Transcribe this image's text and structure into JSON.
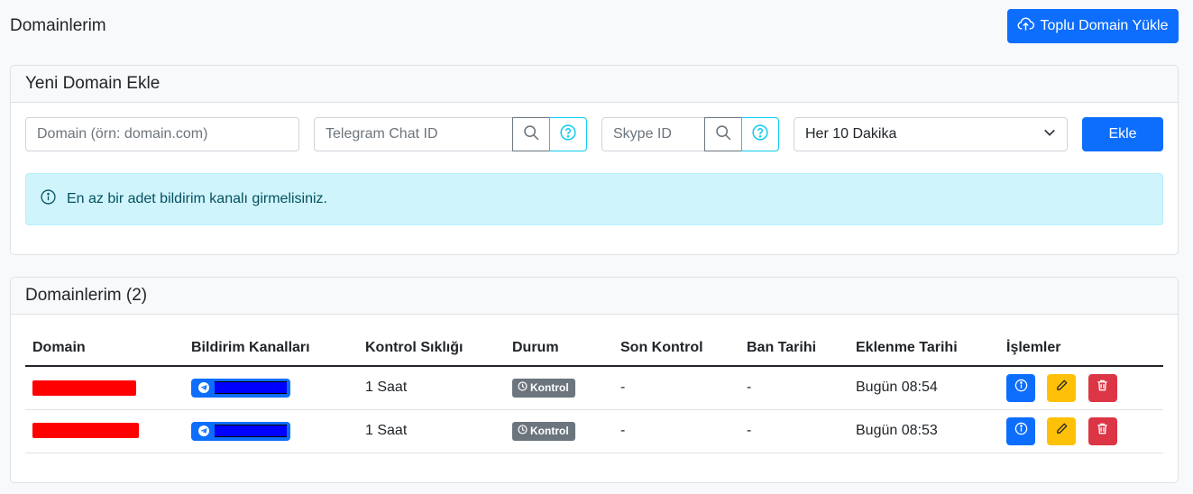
{
  "header": {
    "title": "Domainlerim",
    "bulk_upload_label": "Toplu Domain Yükle",
    "bulk_upload_icon": "cloud-upload-icon"
  },
  "new_domain": {
    "title": "Yeni Domain Ekle",
    "domain_placeholder": "Domain (örn: domain.com)",
    "telegram_placeholder": "Telegram Chat ID",
    "skype_placeholder": "Skype ID",
    "frequency_selected": "Her 10 Dakika",
    "add_label": "Ekle",
    "alert_text": "En az bir adet bildirim kanalı girmelisiniz."
  },
  "domains": {
    "title": "Domainlerim (2)",
    "columns": [
      "Domain",
      "Bildirim Kanalları",
      "Kontrol Sıklığı",
      "Durum",
      "Son Kontrol",
      "Ban Tarihi",
      "Eklenme Tarihi",
      "İşlemler"
    ],
    "rows": [
      {
        "frequency": "1 Saat",
        "status": "Kontrol",
        "last_check": "-",
        "ban_date": "-",
        "added": "Bugün 08:54"
      },
      {
        "frequency": "1 Saat",
        "status": "Kontrol",
        "last_check": "-",
        "ban_date": "-",
        "added": "Bugün 08:53"
      }
    ]
  },
  "colors": {
    "primary": "#0d6efd",
    "info": "#0dcaf0",
    "warning": "#ffc107",
    "danger": "#dc3545",
    "secondary": "#6c757d"
  }
}
